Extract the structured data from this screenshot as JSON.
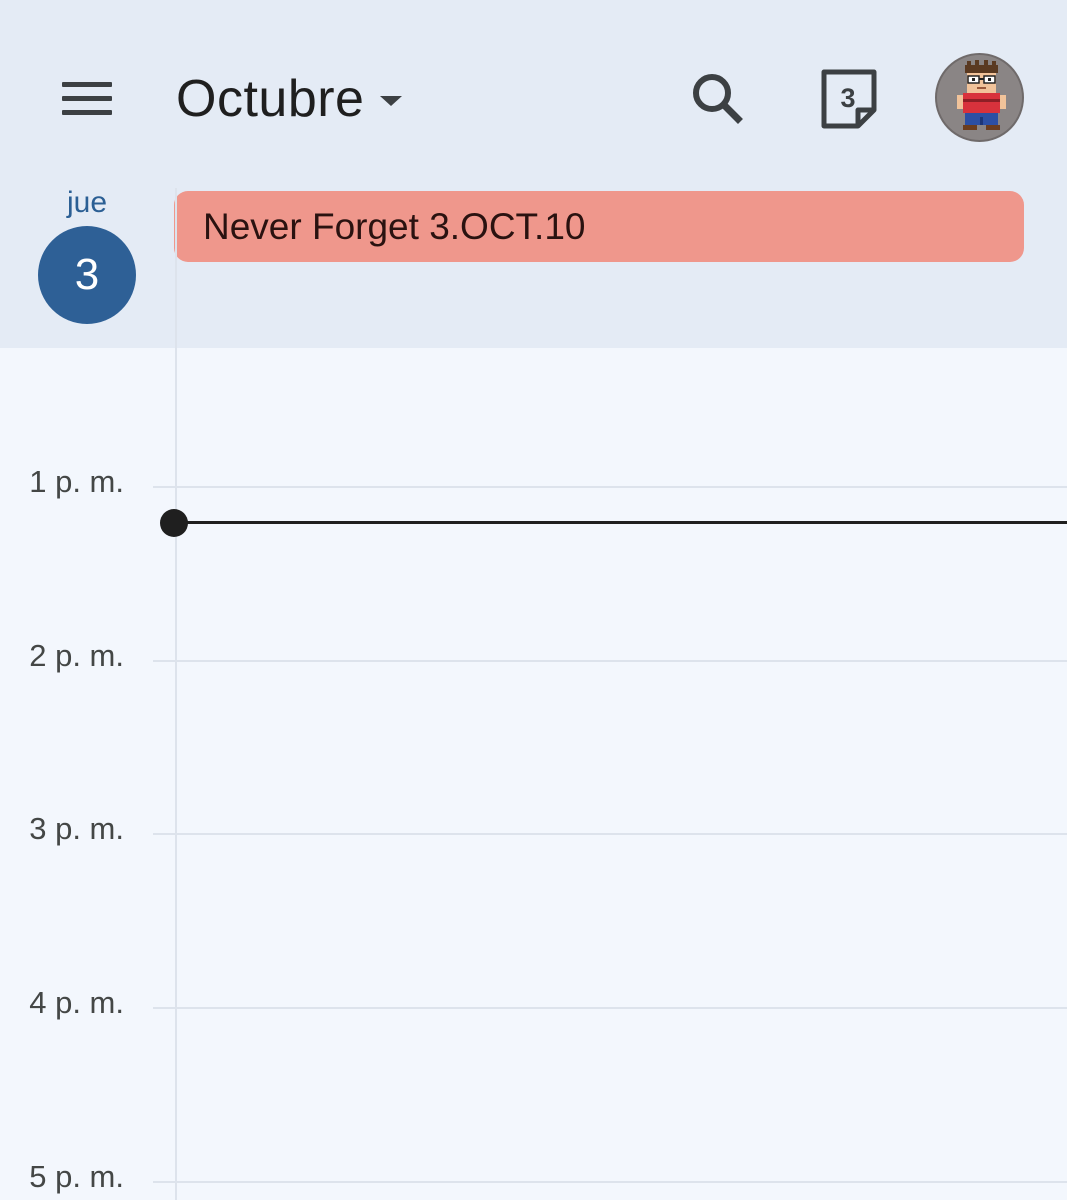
{
  "header": {
    "month": "Octubre",
    "today_number": "3"
  },
  "day": {
    "weekday": "jue",
    "number": "3"
  },
  "event": {
    "title": "Never Forget 3.OCT.10",
    "color": "#ef978c"
  },
  "hours": [
    "1 p. m.",
    "2 p. m.",
    "3 p. m.",
    "4 p. m.",
    "5 p. m."
  ],
  "icons": {
    "menu": "hamburger-menu-icon",
    "dropdown": "caret-down-icon",
    "search": "search-icon",
    "today": "calendar-today-icon",
    "avatar": "pixel-character-avatar"
  },
  "colors": {
    "header_bg": "#e4ebf5",
    "grid_bg": "#f3f7fd",
    "accent": "#2e6096",
    "now_indicator": "#1f1f1f"
  }
}
